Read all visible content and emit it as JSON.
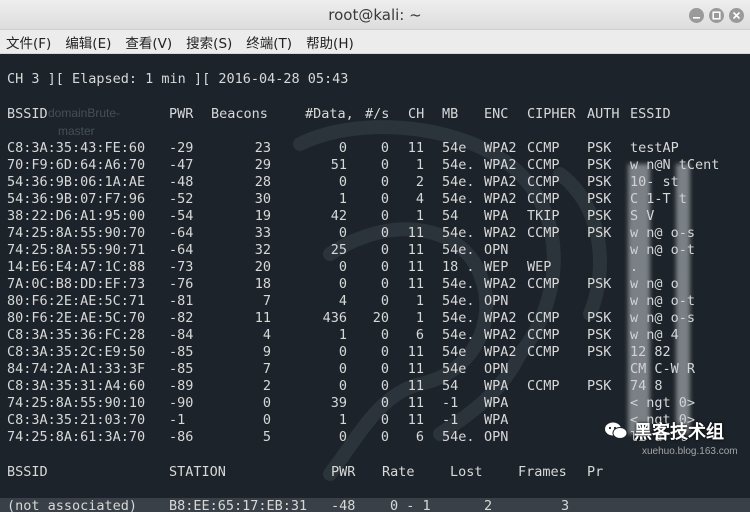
{
  "window": {
    "title": "root@kali: ~",
    "colors": {
      "terminal_bg": "#1c232a",
      "text": "#d8d8d8"
    }
  },
  "menu": [
    "文件(F)",
    "编辑(E)",
    "查看(V)",
    "搜索(S)",
    "终端(T)",
    "帮助(H)"
  ],
  "status": {
    "channel": "CH  3 ][ Elapsed: 1 min ][ 2016-04-28 05:43"
  },
  "ap_table": {
    "headers": [
      "BSSID",
      "PWR",
      "Beacons",
      "#Data,",
      "#/s",
      "CH",
      "MB",
      "ENC",
      "CIPHER",
      "AUTH",
      "ESSID"
    ],
    "rows": [
      [
        "C8:3A:35:43:FE:60",
        "-29",
        "23",
        "0",
        "0",
        "11",
        "54e",
        "WPA2",
        "CCMP",
        "PSK",
        "testAP"
      ],
      [
        "70:F9:6D:64:A6:70",
        "-47",
        "29",
        "51",
        "0",
        "1",
        "54e.",
        "WPA2",
        "CCMP",
        "PSK",
        "w   n@N tCent"
      ],
      [
        "54:36:9B:06:1A:AE",
        "-48",
        "28",
        "0",
        "0",
        "2",
        "54e.",
        "WPA2",
        "CCMP",
        "PSK",
        "  10-   st"
      ],
      [
        "54:36:9B:07:F7:96",
        "-52",
        "30",
        "1",
        "0",
        "4",
        "54e.",
        "WPA2",
        "CCMP",
        "PSK",
        "C  1-T   t"
      ],
      [
        "38:22:D6:A1:95:00",
        "-54",
        "19",
        "42",
        "0",
        "1",
        "54",
        "WPA",
        "TKIP",
        "PSK",
        "S  V"
      ],
      [
        "74:25:8A:55:90:70",
        "-64",
        "33",
        "0",
        "0",
        "11",
        "54e.",
        "WPA2",
        "CCMP",
        "PSK",
        "w   n@   o-s"
      ],
      [
        "74:25:8A:55:90:71",
        "-64",
        "32",
        "25",
        "0",
        "11",
        "54e.",
        "OPN",
        "",
        "",
        "w   n@   o-t"
      ],
      [
        "14:E6:E4:A7:1C:88",
        "-73",
        "20",
        "0",
        "0",
        "11",
        "18 .",
        "WEP",
        "WEP",
        "",
        "."
      ],
      [
        "7A:0C:B8:DD:EF:73",
        "-76",
        "18",
        "0",
        "0",
        "11",
        "54e.",
        "WPA2",
        "CCMP",
        "PSK",
        "w   n@   o"
      ],
      [
        "80:F6:2E:AE:5C:71",
        "-81",
        "7",
        "4",
        "0",
        "1",
        "54e.",
        "OPN",
        "",
        "",
        "w   n@   o-t"
      ],
      [
        "80:F6:2E:AE:5C:70",
        "-82",
        "11",
        "436",
        "20",
        "1",
        "54e.",
        "WPA2",
        "CCMP",
        "PSK",
        "w   n@   o-s"
      ],
      [
        "C8:3A:35:36:FC:28",
        "-84",
        "4",
        "1",
        "0",
        "6",
        "54e.",
        "WPA2",
        "CCMP",
        "PSK",
        "w   n@   4"
      ],
      [
        "C8:3A:35:2C:E9:50",
        "-85",
        "9",
        "0",
        "0",
        "11",
        "54e",
        "WPA2",
        "CCMP",
        "PSK",
        "12   82"
      ],
      [
        "84:74:2A:A1:33:3F",
        "-85",
        "7",
        "0",
        "0",
        "11",
        "54e",
        "OPN",
        "",
        "",
        "CM   C-W   R"
      ],
      [
        "C8:3A:35:31:A4:60",
        "-89",
        "2",
        "0",
        "0",
        "11",
        "54",
        "WPA",
        "CCMP",
        "PSK",
        "74   8"
      ],
      [
        "74:25:8A:55:90:10",
        "-90",
        "0",
        "39",
        "0",
        "11",
        "-1",
        "WPA",
        "",
        "",
        "<   ngt      0>"
      ],
      [
        "C8:3A:35:21:03:70",
        "-1",
        "0",
        "1",
        "0",
        "11",
        "-1",
        "WPA",
        "",
        "",
        "<   ngt      0>"
      ],
      [
        "74:25:8A:61:3A:70",
        "-86",
        "5",
        "0",
        "0",
        "6",
        "54e.",
        "OPN",
        "",
        "",
        "li   ar   t"
      ]
    ]
  },
  "station_table": {
    "headers": [
      "BSSID",
      "STATION",
      "PWR",
      "Rate",
      "Lost",
      "Frames",
      "Pr"
    ],
    "rows": [
      [
        "(not associated)",
        "B8:EE:65:17:EB:31",
        "-48",
        "0 - 1",
        "2",
        "3",
        ""
      ]
    ]
  },
  "background_text": [
    "domainBrute-",
    "master"
  ],
  "watermark": {
    "label": "黑客技术组",
    "url": "xuehuo.blog.163.com",
    "icon": "wechat-icon"
  }
}
